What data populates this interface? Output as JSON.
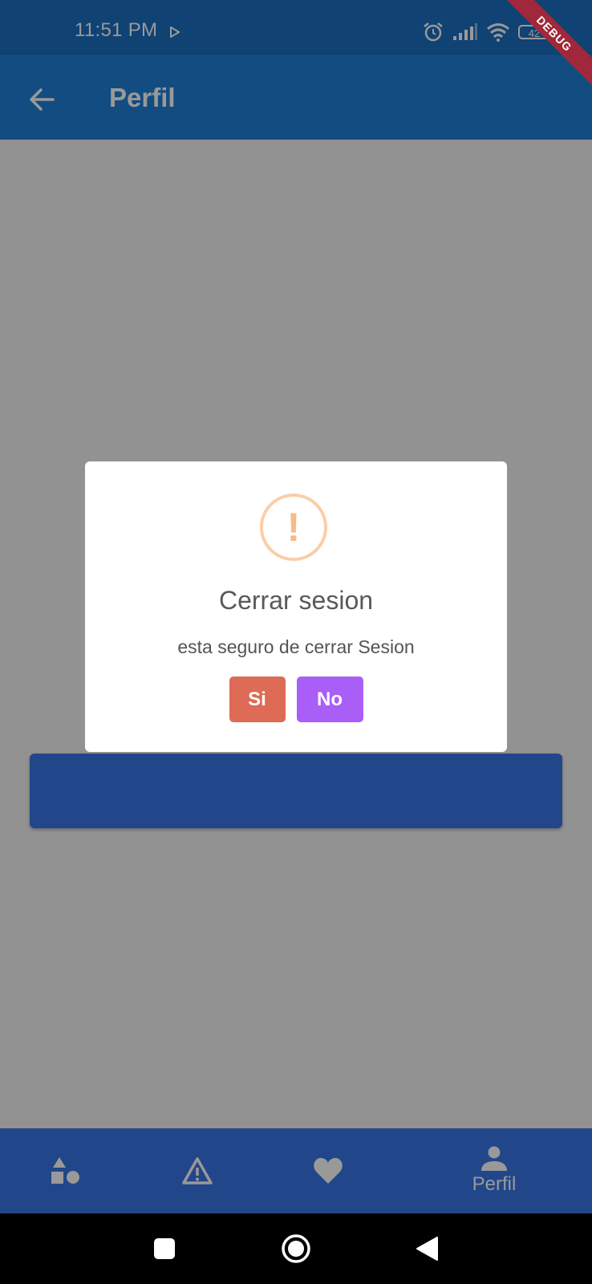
{
  "status_bar": {
    "time": "11:51 PM",
    "battery": "42",
    "debug_label": "DEBUG",
    "icons": [
      "play-icon",
      "alarm-icon",
      "signal-icon",
      "wifi-icon",
      "battery-icon"
    ]
  },
  "app_bar": {
    "title": "Perfil",
    "back_icon": "arrow-left-icon"
  },
  "dialog": {
    "icon": "warning-icon",
    "icon_glyph": "!",
    "title": "Cerrar sesion",
    "text": "esta seguro de cerrar Sesion",
    "confirm_label": "Si",
    "cancel_label": "No"
  },
  "bottom_nav": {
    "items": [
      {
        "icon": "shapes-icon",
        "label": ""
      },
      {
        "icon": "warning-triangle-icon",
        "label": ""
      },
      {
        "icon": "heart-icon",
        "label": ""
      },
      {
        "icon": "person-icon",
        "label": "Perfil",
        "selected": true
      }
    ]
  },
  "system_nav": [
    "recents-icon",
    "home-icon",
    "back-icon"
  ],
  "colors": {
    "app_bar": "#1e7fd8",
    "status_bar": "#1b6fc2",
    "bottom_nav": "#3a75e6",
    "confirm_button": "#dd6b55",
    "cancel_button": "#a95ef8",
    "warning": "#f8bb86"
  }
}
